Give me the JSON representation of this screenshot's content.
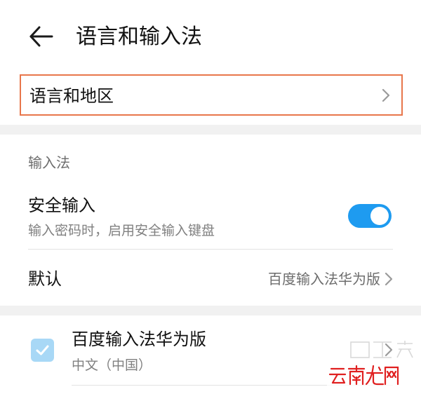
{
  "header": {
    "title": "语言和输入法",
    "back_icon": "back-arrow-icon"
  },
  "language_region": {
    "label": "语言和地区"
  },
  "input_section": {
    "title": "输入法",
    "secure_input": {
      "label": "安全输入",
      "description": "输入密码时，启用安全输入键盘",
      "toggle_on": true
    },
    "default_row": {
      "label": "默认",
      "value": "百度输入法华为版"
    }
  },
  "ime_list": [
    {
      "name": "百度输入法华为版",
      "language": "中文（中国）",
      "checked": true
    }
  ],
  "watermark": {
    "brand": "云南龙网"
  },
  "colors": {
    "accent": "#1e9bf0",
    "highlight_border": "#e8764b",
    "checkbox": "#a8d8f6",
    "section_gap": "#f1f1f1"
  }
}
